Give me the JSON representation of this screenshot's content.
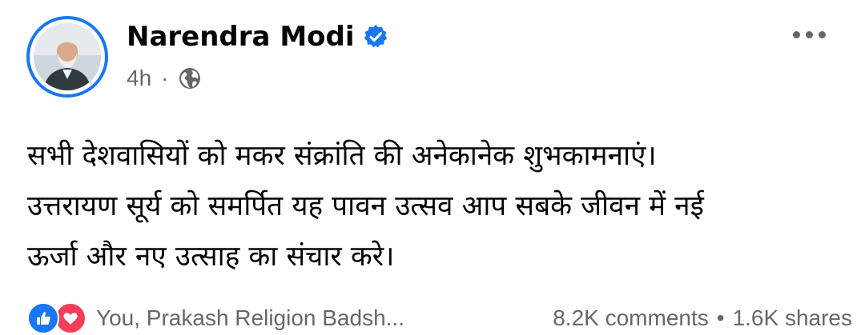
{
  "author": {
    "name": "Narendra Modi",
    "time": "4h",
    "separator": "·"
  },
  "post": {
    "lines": [
      "सभी देशवासियों को मकर संक्रांति की अनेकानेक शुभकामनाएं।",
      "उत्तरायण सूर्य को समर्पित यह पावन उत्सव आप सबके जीवन में नई",
      "ऊर्जा और नए उत्साह का संचार करे।"
    ]
  },
  "reactions": {
    "reactors": "You, Prakash Religion Badsh...",
    "comments": "8.2K comments",
    "separator": "•",
    "shares": "1.6K shares"
  },
  "colors": {
    "accent": "#1877f2",
    "love": "#f33e58",
    "secondary_text": "#65676b"
  },
  "icons": [
    "verified-badge-icon",
    "globe-icon",
    "more-options-icon",
    "like-reaction-icon",
    "love-reaction-icon"
  ]
}
